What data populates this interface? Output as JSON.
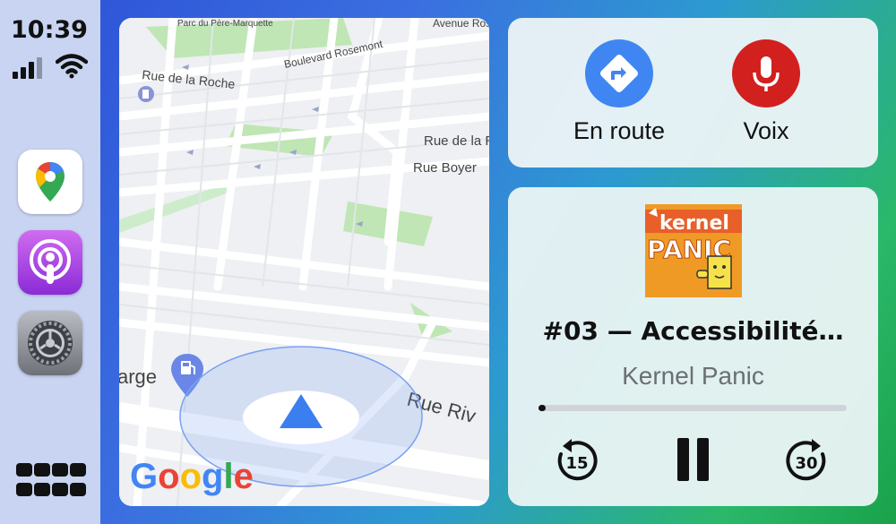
{
  "status": {
    "time": "10:39"
  },
  "sidebar": {
    "apps": [
      {
        "name": "Google Maps",
        "icon": "google-maps-icon"
      },
      {
        "name": "Podcasts",
        "icon": "podcasts-icon"
      },
      {
        "name": "Settings",
        "icon": "settings-icon"
      }
    ],
    "home_icon": "app-grid-icon"
  },
  "map": {
    "streets": {
      "parc": "Parc du Père-Marquette",
      "rosemont": "Boulevard Rosemont",
      "avenue": "Avenue Rose",
      "roche": "Rue de la Roche",
      "rue_de_la": "Rue de la R",
      "boyer": "Rue Boyer",
      "riv": "Rue Riv",
      "charge": "arge"
    },
    "logo": "Google"
  },
  "nav_shortcuts": {
    "en_route_label": "En route",
    "voice_label": "Voix",
    "colors": {
      "en_route": "#3f86f2",
      "voice": "#d2201e"
    }
  },
  "now_playing": {
    "artwork_text_1": "kernel",
    "artwork_text_2": "PANIC",
    "episode_title": "#03 — Accessibilité…",
    "podcast": "Kernel Panic",
    "progress": 0.01,
    "skip_back_label": "15",
    "skip_forward_label": "30"
  }
}
